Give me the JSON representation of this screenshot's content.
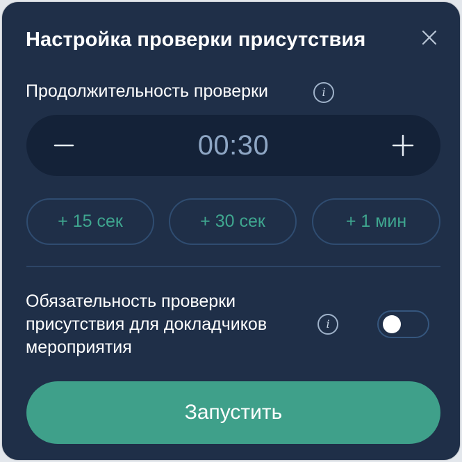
{
  "dialog": {
    "title": "Настройка проверки присутствия",
    "close_icon": "close-icon"
  },
  "duration": {
    "label": "Продолжительность проверки",
    "info_icon": "info-icon",
    "value": "00:30",
    "decrement_icon": "minus-icon",
    "increment_icon": "plus-icon"
  },
  "presets": [
    {
      "label": "+ 15 сек"
    },
    {
      "label": "+ 30 сек"
    },
    {
      "label": "+ 1 мин"
    }
  ],
  "mandatory": {
    "label": "Обязательность проверки присутствия для докладчиков мероприятия",
    "info_icon": "info-icon",
    "enabled": false
  },
  "start_button": {
    "label": "Запустить"
  },
  "colors": {
    "background": "#1f2f48",
    "stepper_background": "#142238",
    "accent": "#3fa08a",
    "preset_text": "#3fa68f",
    "value_text": "#8ea6c4"
  }
}
